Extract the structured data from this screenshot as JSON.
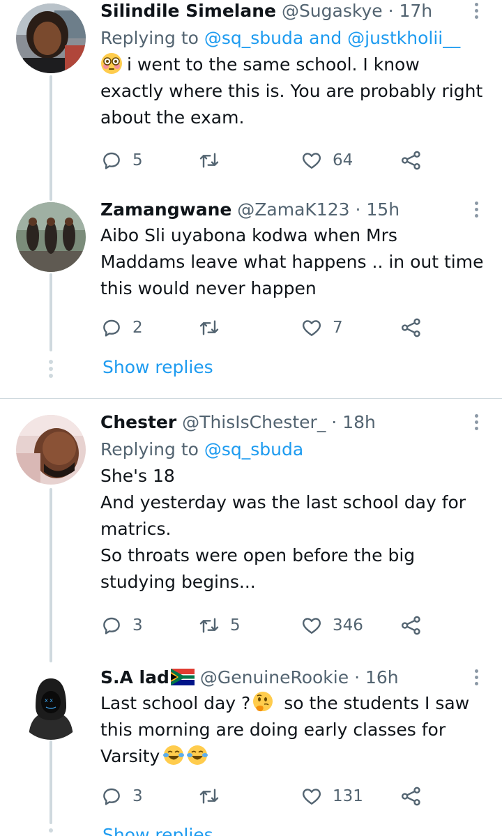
{
  "tweets": [
    {
      "name": "Silindile Simelane",
      "handle": "@Sugaskye",
      "sep": "·",
      "time": "17h",
      "replying_prefix": "Replying to ",
      "replying_to": "@sq_sbuda and @justkholii__",
      "lines": [
        "i went to the same school. I know",
        "exactly where this is. You are probably right",
        "about the exam."
      ],
      "leading_emoji": "flushed-face",
      "replies": "5",
      "retweets": "",
      "likes": "64"
    },
    {
      "name": "Zamangwane",
      "handle": "@ZamaK123",
      "sep": "·",
      "time": "15h",
      "lines": [
        "Aibo Sli uyabona kodwa when Mrs",
        "Maddams leave what happens .. in out time",
        "this would never happen"
      ],
      "replies": "2",
      "retweets": "",
      "likes": "7"
    },
    {
      "name": "Chester",
      "handle": "@ThisIsChester_",
      "sep": "·",
      "time": "18h",
      "replying_prefix": "Replying to ",
      "replying_to": "@sq_sbuda",
      "lines": [
        "She's 18",
        "And yesterday was the last school day for",
        "matrics.",
        "So throats were open before the big",
        "studying begins..."
      ],
      "replies": "3",
      "retweets": "5",
      "likes": "346"
    },
    {
      "name": "S.A lad",
      "name_flag": "south-africa-flag",
      "handle": "@GenuineRookie",
      "sep": "·",
      "time": "16h",
      "line1_a": "Last school day ?",
      "line1_emoji": "thinking-face",
      "line1_b": " so the students I saw",
      "line2": "this morning are doing early classes for",
      "line3": "Varsity",
      "line3_emojis": [
        "face-with-tears-of-joy",
        "face-with-tears-of-joy"
      ],
      "replies": "3",
      "retweets": "",
      "likes": "131"
    }
  ],
  "show_replies_label": "Show replies",
  "icons": {
    "reply": "reply-icon",
    "retweet": "retweet-icon",
    "like": "heart-icon",
    "share": "share-icon",
    "more": "more-options-icon"
  },
  "colors": {
    "link": "#1d9bf0",
    "secondary": "#536471",
    "thread_line": "#cfd9de"
  }
}
